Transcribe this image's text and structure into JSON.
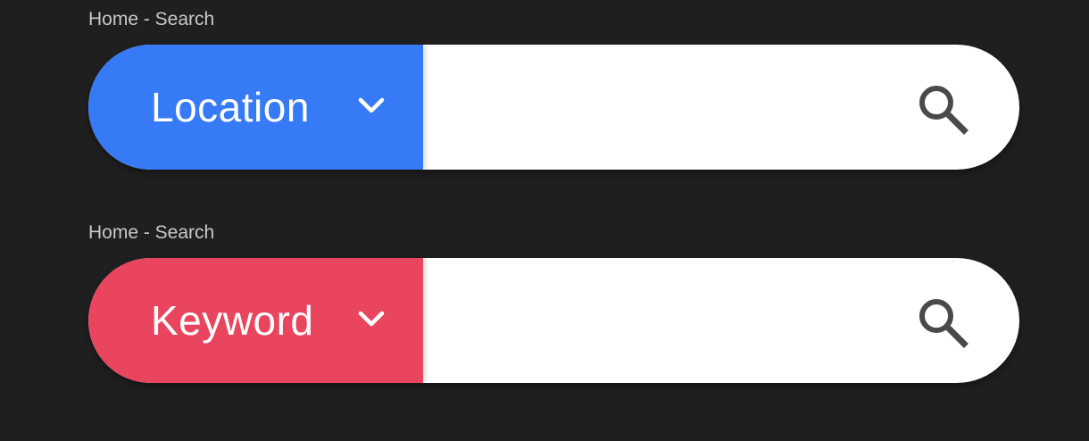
{
  "frames": [
    {
      "label": "Home - Search",
      "selector": {
        "label": "Location",
        "color": "#367af6"
      },
      "input": {
        "value": "",
        "placeholder": ""
      },
      "search_icon": "search-icon",
      "chevron_icon": "chevron-down-icon"
    },
    {
      "label": "Home - Search",
      "selector": {
        "label": "Keyword",
        "color": "#e9455e"
      },
      "input": {
        "value": "",
        "placeholder": ""
      },
      "search_icon": "search-icon",
      "chevron_icon": "chevron-down-icon"
    }
  ],
  "colors": {
    "background": "#1f1f1f",
    "input_background": "#ffffff",
    "icon": "#4a4a4a",
    "label_text": "#c9c9c9"
  }
}
